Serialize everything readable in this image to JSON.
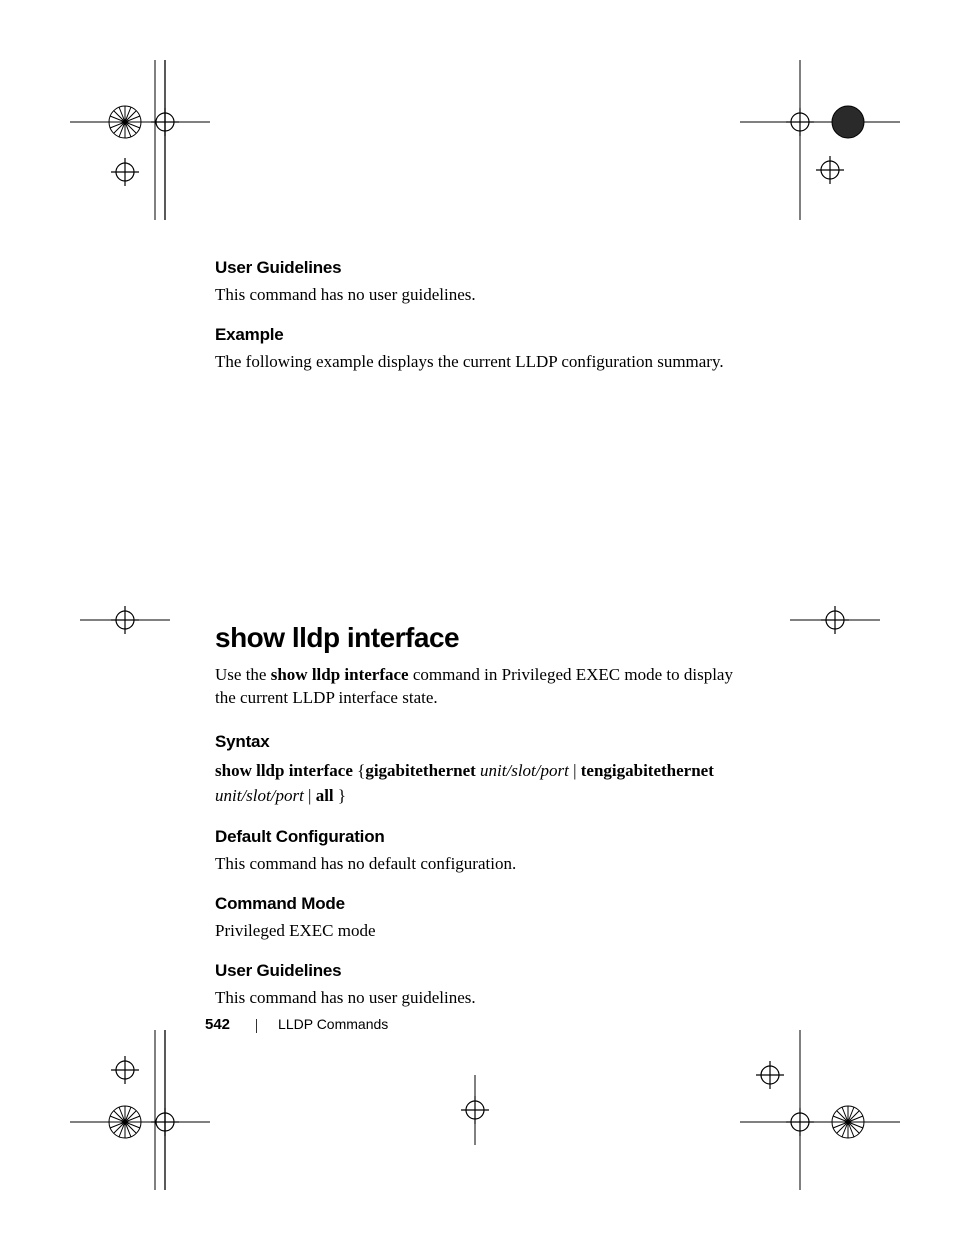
{
  "sections": {
    "user_guidelines_1": {
      "heading": "User Guidelines",
      "body": "This command has no user guidelines."
    },
    "example": {
      "heading": "Example",
      "body": "The following example displays the current LLDP configuration summary."
    }
  },
  "command": {
    "title": "show lldp interface",
    "intro_pre": "Use the ",
    "intro_cmd": "show lldp interface",
    "intro_post": " command in Privileged EXEC mode to display the current LLDP interface state.",
    "syntax": {
      "heading": "Syntax",
      "line1_b1": "show lldp interface",
      "line1_t1": " {",
      "line1_b2": "gigabitethernet",
      "line1_sp": " ",
      "line1_i1": "unit/slot/port",
      "line1_t2": " | ",
      "line1_b3": "tengigabitethernet",
      "line2_i1": "unit/slot/port",
      "line2_t1": " | ",
      "line2_b1": "all",
      "line2_t2": " }"
    },
    "default_cfg": {
      "heading": "Default Configuration",
      "body": "This command has no default configuration."
    },
    "mode": {
      "heading": "Command Mode",
      "body": "Privileged EXEC mode"
    },
    "user_guidelines_2": {
      "heading": "User Guidelines",
      "body": "This command has no user guidelines."
    }
  },
  "footer": {
    "page": "542",
    "chapter": "LLDP Commands"
  }
}
